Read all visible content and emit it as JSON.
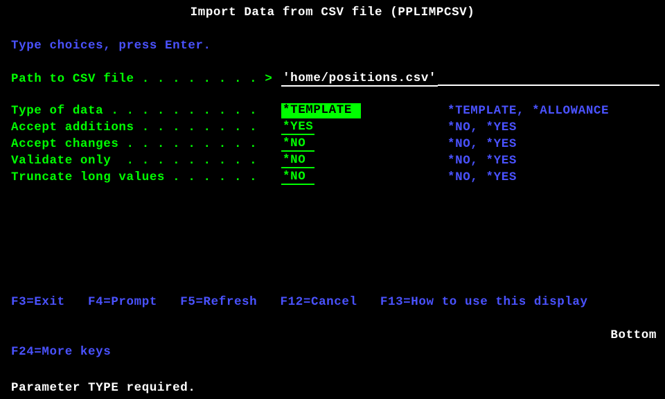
{
  "title": "Import Data from CSV file (PPLIMPCSV)",
  "instruction": "Type choices, press Enter.",
  "path": {
    "label": "Path to CSV file . . . . . . . . >",
    "value": "'home/positions.csv'"
  },
  "fields": [
    {
      "label": "Type of data . . . . . . . . . .",
      "value": "*TEMPLATE ",
      "help": "*TEMPLATE, *ALLOWANCE",
      "hilite": true
    },
    {
      "label": "Accept additions . . . . . . . .",
      "value": "*YES",
      "help": "*NO, *YES",
      "hilite": false
    },
    {
      "label": "Accept changes . . . . . . . . .",
      "value": "*NO ",
      "help": "*NO, *YES",
      "hilite": false
    },
    {
      "label": "Validate only  . . . . . . . . .",
      "value": "*NO ",
      "help": "*NO, *YES",
      "hilite": false
    },
    {
      "label": "Truncate long values . . . . . .",
      "value": "*NO ",
      "help": "*NO, *YES",
      "hilite": false
    }
  ],
  "bottom_marker": "Bottom",
  "fkeys_line1": "F3=Exit   F4=Prompt   F5=Refresh   F12=Cancel   F13=How to use this display",
  "fkeys_line2": "F24=More keys",
  "message": "Parameter TYPE required."
}
